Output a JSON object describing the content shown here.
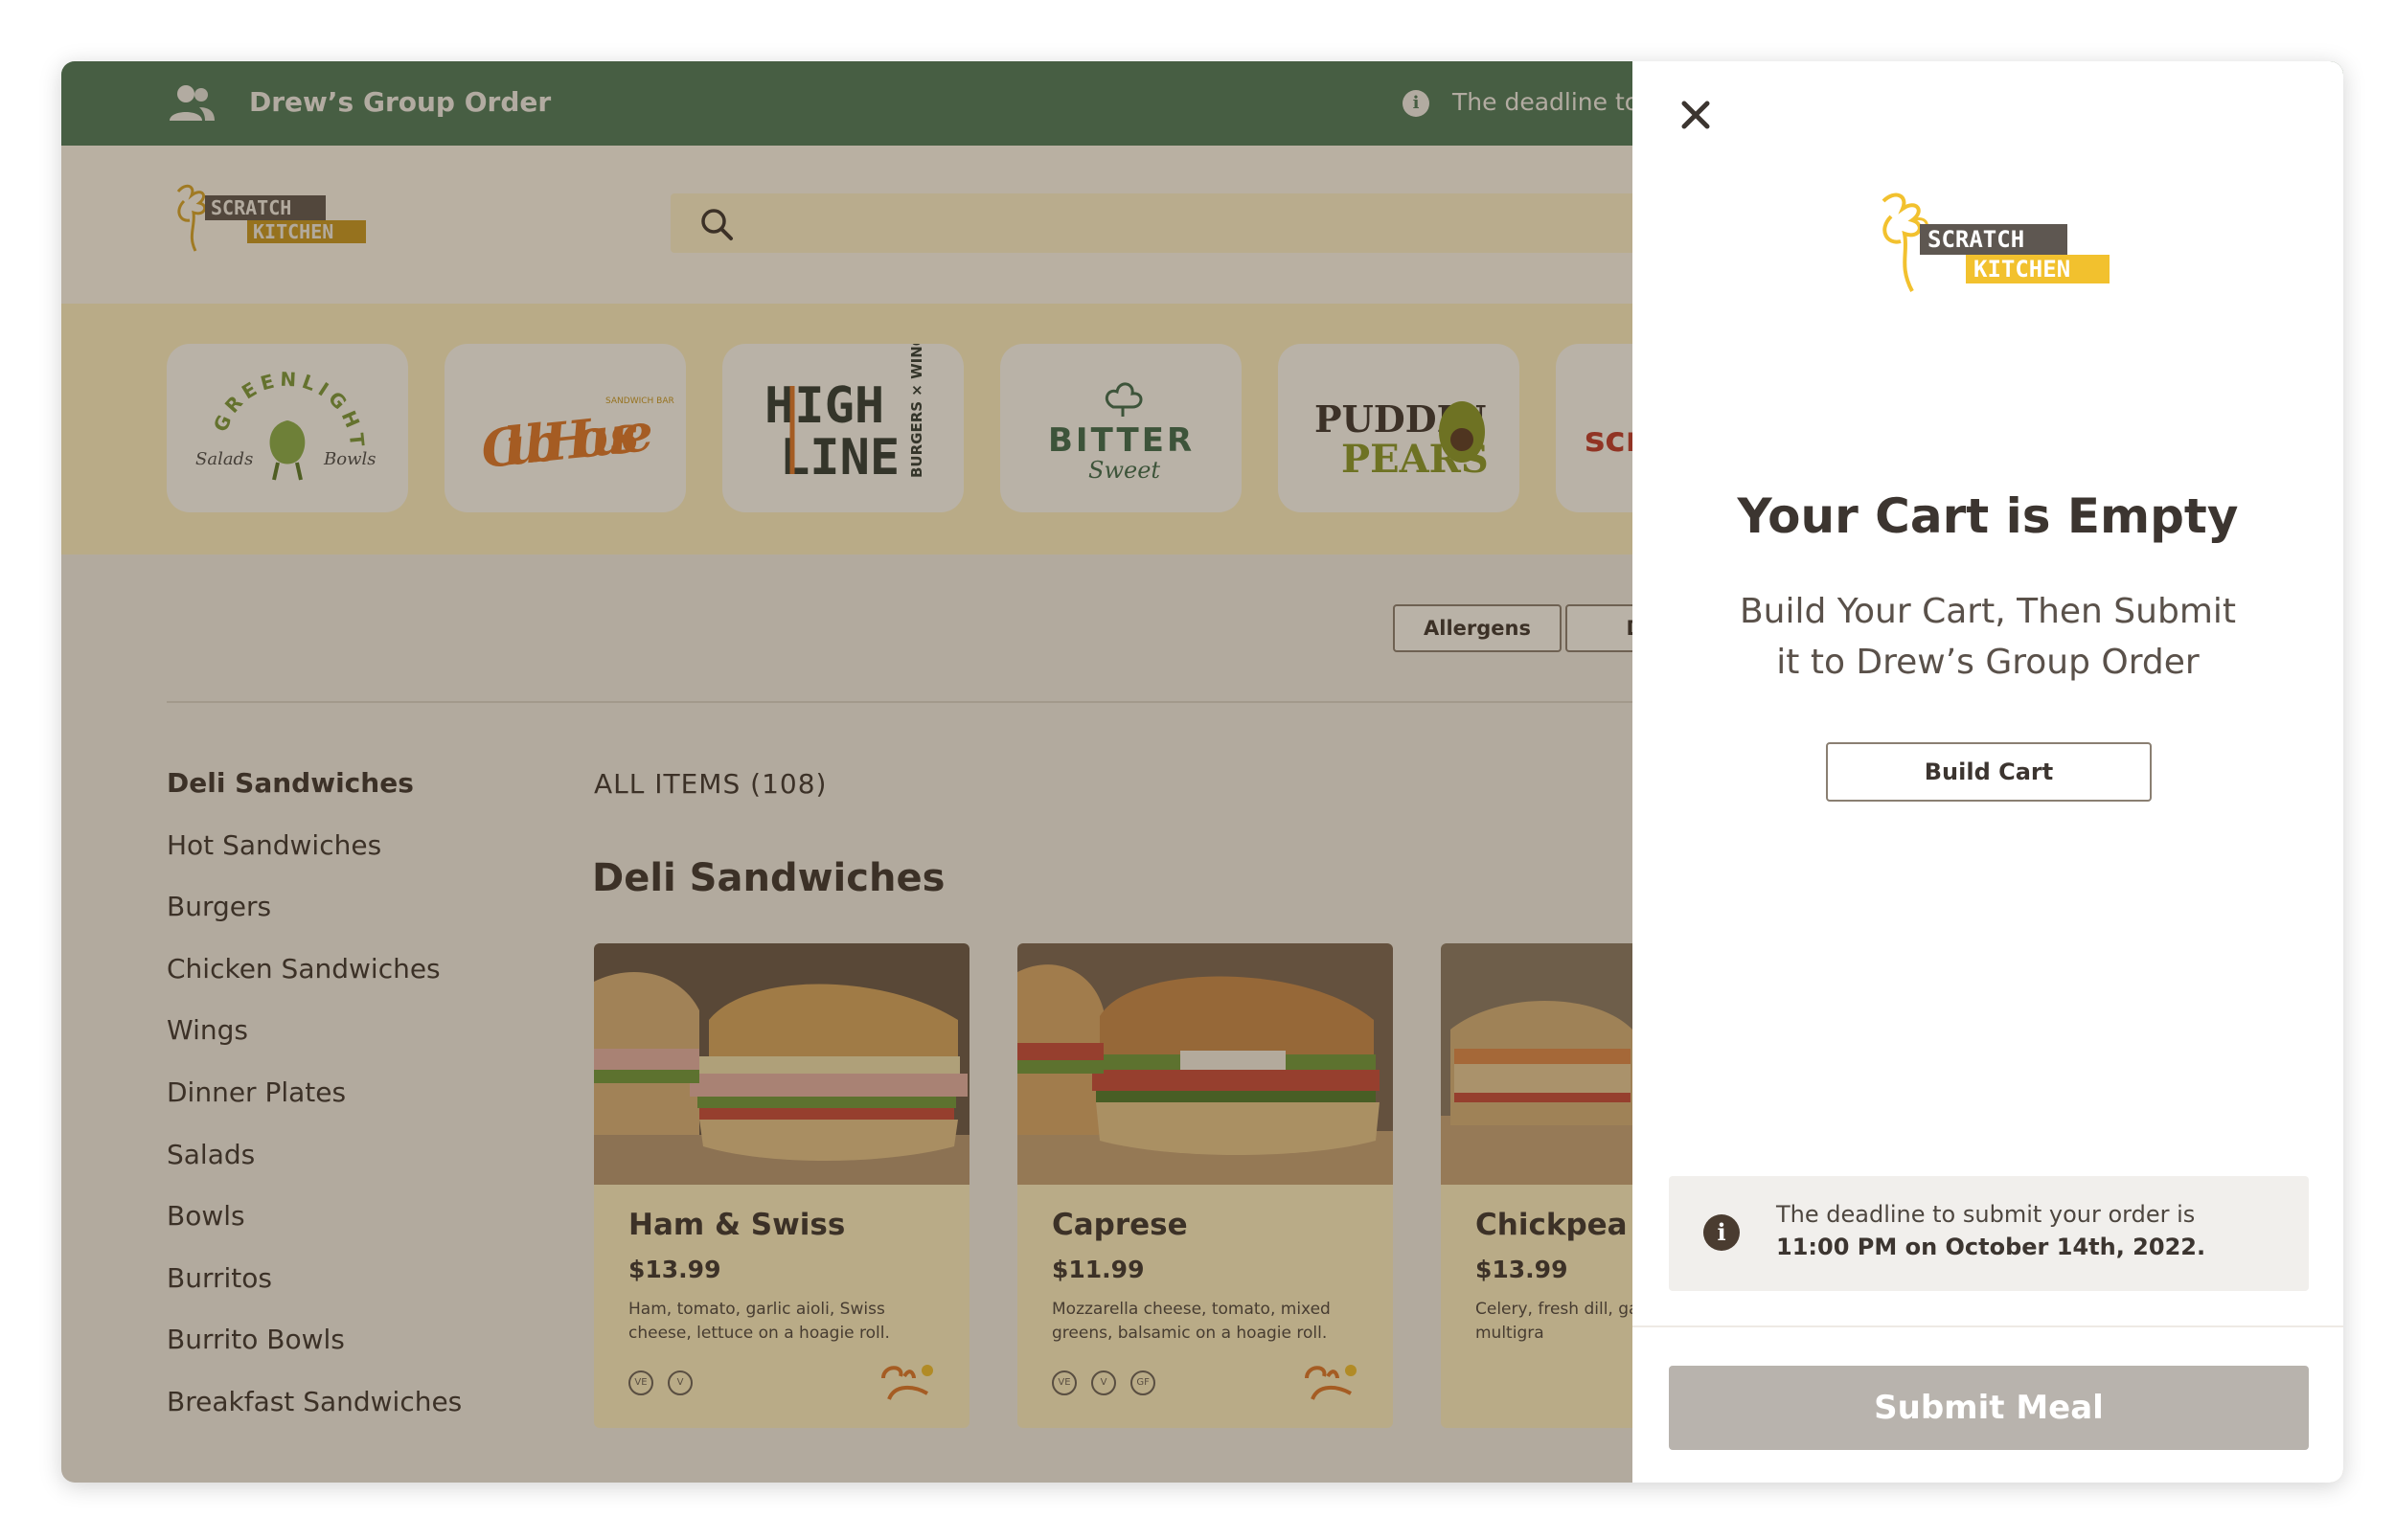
{
  "topbar": {
    "title": "Drew’s Group Order",
    "deadline_text": "The deadline to submit your order is 11:00 PM on October 14th, 2022."
  },
  "header": {
    "logo_text_top": "SCRATCH",
    "logo_text_bottom": "KITCHEN"
  },
  "brands": [
    {
      "name": "GREENLIGHT",
      "sub_left": "Salads",
      "sub_right": "Bowls"
    },
    {
      "name": "Club House",
      "sub": "SANDWICH BAR"
    },
    {
      "name_top": "HIGH",
      "name_bottom": "LINE",
      "sub": "BURGERS × WINGS"
    },
    {
      "name": "BITTER",
      "sub": "Sweet"
    },
    {
      "name_top": "PUDDIN",
      "name_bottom": "PEARS"
    },
    {
      "name": "scr"
    }
  ],
  "filters": {
    "allergens": "Allergens",
    "diet": "Diet"
  },
  "categories": [
    "Deli Sandwiches",
    "Hot Sandwiches",
    "Burgers",
    "Chicken Sandwiches",
    "Wings",
    "Dinner Plates",
    "Salads",
    "Bowls",
    "Burritos",
    "Burrito Bowls",
    "Breakfast Sandwiches"
  ],
  "menu": {
    "all_items": "ALL ITEMS (108)",
    "section_title": "Deli Sandwiches",
    "items": [
      {
        "name": "Ham & Swiss",
        "price": "$13.99",
        "desc": "Ham, tomato, garlic aioli, Swiss cheese, lettuce on a hoagie roll.",
        "badges": [
          "VE",
          "V"
        ]
      },
      {
        "name": "Caprese",
        "price": "$11.99",
        "desc": "Mozzarella cheese, tomato, mixed greens, balsamic on a hoagie roll.",
        "badges": [
          "VE",
          "V",
          "GF"
        ]
      },
      {
        "name": "Chickpea S",
        "price": "$13.99",
        "desc": "Celery, fresh dill, ga carrots on multigra",
        "badges": []
      }
    ]
  },
  "cart": {
    "title": "Your Cart is Empty",
    "subtitle": "Build Your Cart, Then Submit it to Drew’s Group Order",
    "build_button": "Build Cart",
    "deadline_line1": "The deadline to submit your order is",
    "deadline_line2": "11:00 PM on October 14th, 2022.",
    "submit_button": "Submit Meal"
  },
  "colors": {
    "topbar": "#4d7a5b",
    "brand_yellow": "#f2c12e",
    "text_dark": "#3c3530",
    "submit_disabled": "#b8b3ad"
  }
}
